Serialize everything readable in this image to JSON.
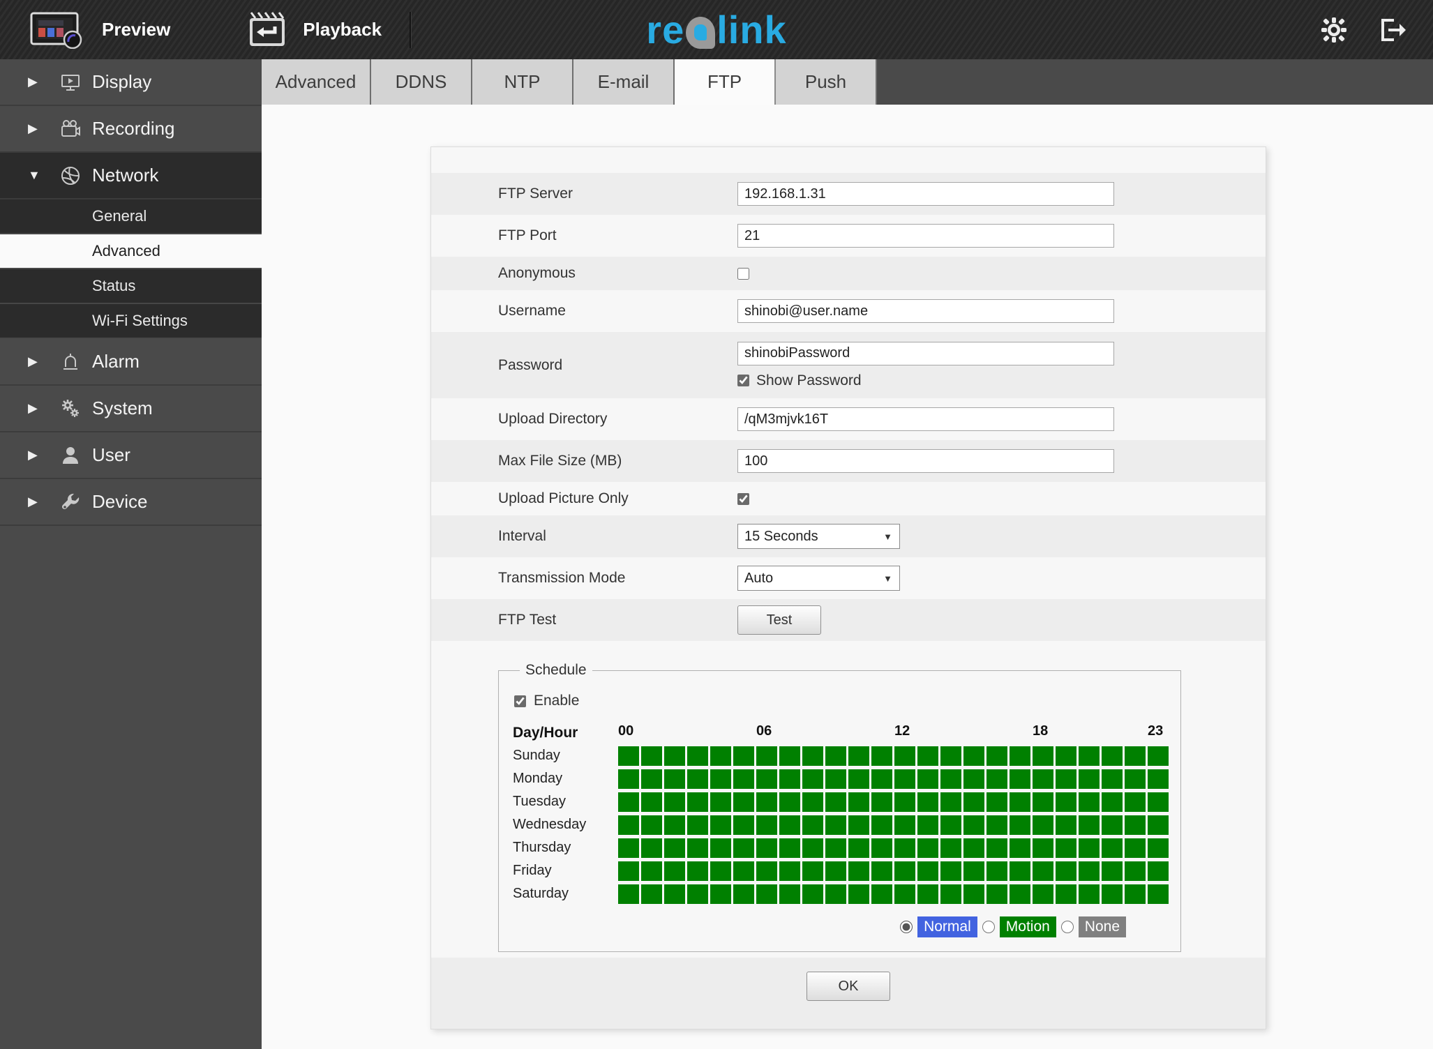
{
  "topbar": {
    "preview_label": "Preview",
    "playback_label": "Playback",
    "logo": {
      "part1": "re",
      "part2": "link",
      "blue": "#29abe2",
      "gray": "#9a9a9a"
    }
  },
  "sidebar": {
    "items": [
      {
        "label": "Display",
        "state": "collapsed"
      },
      {
        "label": "Recording",
        "state": "collapsed"
      },
      {
        "label": "Network",
        "state": "expanded"
      },
      {
        "label": "Alarm",
        "state": "collapsed"
      },
      {
        "label": "System",
        "state": "collapsed"
      },
      {
        "label": "User",
        "state": "collapsed"
      },
      {
        "label": "Device",
        "state": "collapsed"
      }
    ],
    "network_children": [
      {
        "label": "General",
        "selected": false
      },
      {
        "label": "Advanced",
        "selected": true
      },
      {
        "label": "Status",
        "selected": false
      },
      {
        "label": "Wi-Fi Settings",
        "selected": false
      }
    ]
  },
  "tabs": {
    "items": [
      "Advanced",
      "DDNS",
      "NTP",
      "E-mail",
      "FTP",
      "Push"
    ],
    "active": "FTP"
  },
  "form": {
    "ftp_server": {
      "label": "FTP Server",
      "value": "192.168.1.31"
    },
    "ftp_port": {
      "label": "FTP Port",
      "value": "21"
    },
    "anonymous": {
      "label": "Anonymous",
      "checked": false
    },
    "username": {
      "label": "Username",
      "value": "shinobi@user.name"
    },
    "password": {
      "label": "Password",
      "value": "shinobiPassword",
      "show_password": {
        "label": "Show Password",
        "checked": true
      }
    },
    "upload_directory": {
      "label": "Upload Directory",
      "value": "/qM3mjvk16T"
    },
    "max_file_size": {
      "label": "Max File Size (MB)",
      "value": "100"
    },
    "upload_picture_only": {
      "label": "Upload Picture Only",
      "checked": true
    },
    "interval": {
      "label": "Interval",
      "selected": "15 Seconds"
    },
    "transmission_mode": {
      "label": "Transmission Mode",
      "selected": "Auto"
    },
    "ftp_test": {
      "label": "FTP Test",
      "button_label": "Test"
    }
  },
  "schedule": {
    "legend": "Schedule",
    "enable": {
      "label": "Enable",
      "checked": true
    },
    "day_hour_label": "Day/Hour",
    "hour_labels": [
      {
        "label": "00",
        "col": 0
      },
      {
        "label": "06",
        "col": 6
      },
      {
        "label": "12",
        "col": 12
      },
      {
        "label": "18",
        "col": 18
      },
      {
        "label": "23",
        "col": 23
      }
    ],
    "days": [
      "Sunday",
      "Monday",
      "Tuesday",
      "Wednesday",
      "Thursday",
      "Friday",
      "Saturday"
    ],
    "columns": 24,
    "all_cells_state": "motion",
    "colors": {
      "normal": "#4263e0",
      "motion": "#008000",
      "none": "#808080"
    },
    "legend_options": [
      {
        "label": "Normal",
        "color": "#4263e0",
        "selected": true
      },
      {
        "label": "Motion",
        "color": "#008000",
        "selected": false
      },
      {
        "label": "None",
        "color": "#808080",
        "selected": false
      }
    ]
  },
  "footer": {
    "ok_label": "OK"
  }
}
